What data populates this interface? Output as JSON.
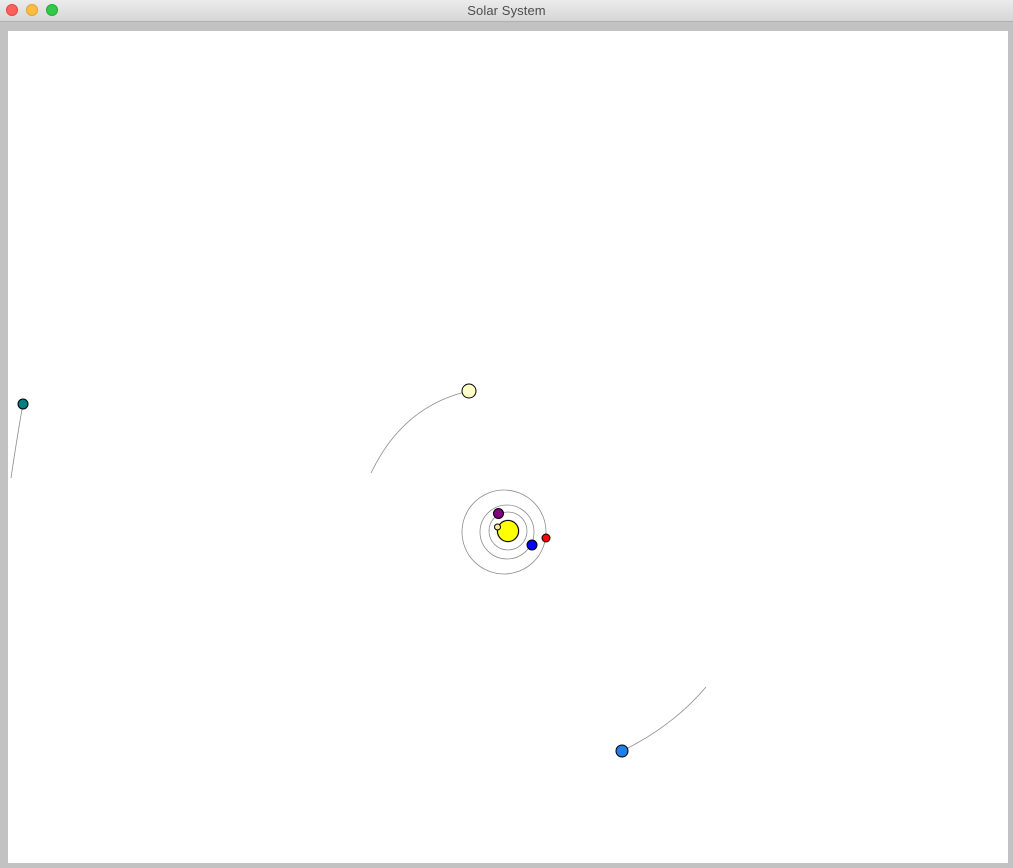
{
  "window": {
    "title": "Solar System"
  },
  "controls": {
    "close_icon": "close-icon",
    "minimize_icon": "minimize-icon",
    "zoom_icon": "zoom-icon"
  },
  "colors": {
    "sun": "#ffff00",
    "planet_tiny": "#ffe4a8",
    "planet_purple": "#800080",
    "planet_blue": "#0000ff",
    "planet_red": "#ff0000",
    "planet_pale": "#ffffc8",
    "planet_teal": "#008080",
    "planet_skyblue": "#1e7fe8",
    "orbit_trail": "#8c8c8c",
    "background": "#ffffff"
  }
}
